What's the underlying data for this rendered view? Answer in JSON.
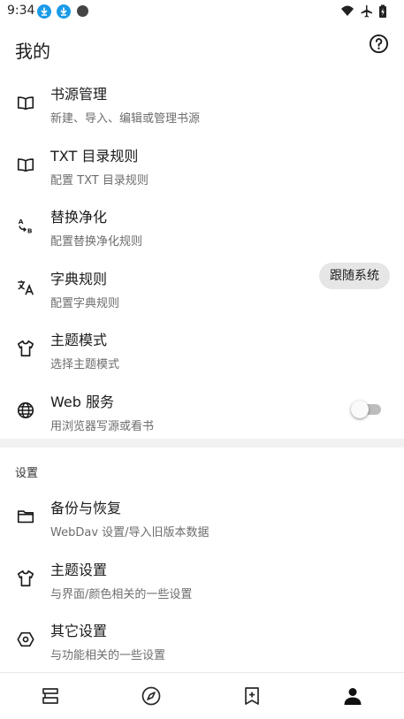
{
  "status_bar": {
    "time": "9:34",
    "icons": [
      "download-icon",
      "download-icon",
      "circle-icon",
      "wifi-icon",
      "airplane-icon",
      "battery-icon"
    ]
  },
  "app_bar": {
    "title": "我的",
    "help_icon": "help-circle-icon"
  },
  "main_items": [
    {
      "id": "book-source",
      "icon": "book-icon",
      "title": "书源管理",
      "subtitle": "新建、导入、编辑或管理书源"
    },
    {
      "id": "txt-toc",
      "icon": "book-icon",
      "title": "TXT 目录规则",
      "subtitle": "配置 TXT 目录规则"
    },
    {
      "id": "replace",
      "icon": "replace-ab-icon",
      "title": "替换净化",
      "subtitle": "配置替换净化规则"
    },
    {
      "id": "dict",
      "icon": "translate-icon",
      "title": "字典规则",
      "subtitle": "配置字典规则"
    },
    {
      "id": "theme-mode",
      "icon": "shirt-icon",
      "title": "主题模式",
      "subtitle": "选择主题模式",
      "value": "跟随系统"
    },
    {
      "id": "web-service",
      "icon": "globe-icon",
      "title": "Web 服务",
      "subtitle": "用浏览器写源或看书",
      "switch_on": false
    }
  ],
  "section_title": "设置",
  "settings_items": [
    {
      "id": "backup",
      "icon": "folder-icon",
      "title": "备份与恢复",
      "subtitle": "WebDav 设置/导入旧版本数据"
    },
    {
      "id": "theme-settings",
      "icon": "shirt-icon",
      "title": "主题设置",
      "subtitle": "与界面/颜色相关的一些设置"
    },
    {
      "id": "other-settings",
      "icon": "hexagon-settings-icon",
      "title": "其它设置",
      "subtitle": "与功能相关的一些设置"
    }
  ],
  "bottom_nav": [
    {
      "id": "bookshelf",
      "icon": "bookshelf-icon",
      "active": false
    },
    {
      "id": "discover",
      "icon": "compass-icon",
      "active": false
    },
    {
      "id": "rss",
      "icon": "bookmark-add-icon",
      "active": false
    },
    {
      "id": "my",
      "icon": "person-icon",
      "active": true
    }
  ],
  "colors": {
    "status_download": "#1a9be8",
    "text_primary": "#1b1b1b",
    "text_secondary": "#6d6d6d",
    "chip_bg": "#e6e6e6",
    "divider": "#f1f1f1"
  }
}
